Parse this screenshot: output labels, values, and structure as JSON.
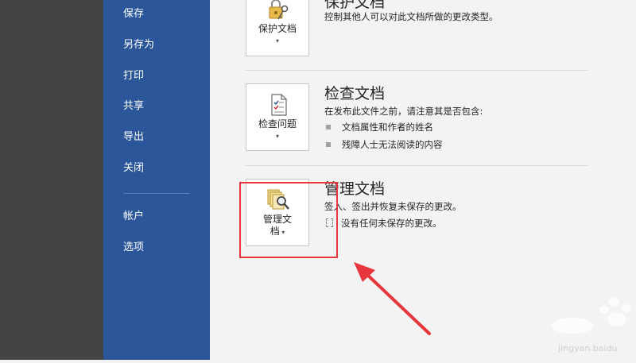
{
  "nav": {
    "items": [
      {
        "id": "save",
        "label": "保存"
      },
      {
        "id": "save-as",
        "label": "另存为"
      },
      {
        "id": "print",
        "label": "打印"
      },
      {
        "id": "share",
        "label": "共享"
      },
      {
        "id": "export",
        "label": "导出"
      },
      {
        "id": "close",
        "label": "关闭"
      }
    ],
    "bottom_items": [
      {
        "id": "account",
        "label": "帐户"
      },
      {
        "id": "options",
        "label": "选项"
      }
    ]
  },
  "sections": {
    "protect": {
      "tile_label": "保护文档",
      "title": "保护文档",
      "description": "控制其他人可以对此文档所做的更改类型。"
    },
    "inspect": {
      "tile_label": "检查问题",
      "title": "检查文档",
      "description": "在发布此文件之前，请注意其是否包含:",
      "bullets": [
        "文档属性和作者的姓名",
        "残障人士无法阅读的内容"
      ]
    },
    "manage": {
      "tile_label_line1": "管理文",
      "tile_label_line2": "档",
      "title": "管理文档",
      "description": "签入、签出并恢复未保存的更改。",
      "note": "没有任何未保存的更改。"
    }
  },
  "colors": {
    "sidebar": "#2b579a",
    "left_panel": "#444444",
    "highlight": "#e8363d"
  },
  "watermark_text": "jingyan.baidu"
}
